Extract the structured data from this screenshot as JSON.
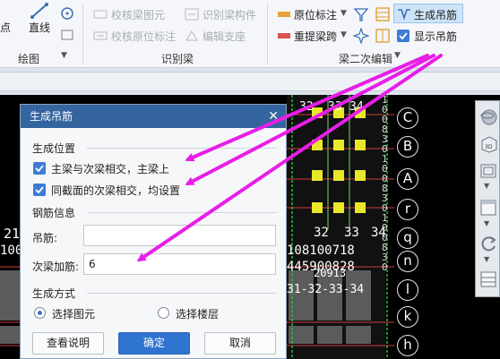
{
  "ribbon": {
    "draw": {
      "dot_label": "点",
      "line_label": "直线",
      "group_label": "绘图"
    },
    "recognize": {
      "check_beam_element": "校核梁图元",
      "recognize_beam_member": "识别梁构件",
      "check_original_annotation": "校核原位标注",
      "edit_support": "编辑支座",
      "group_label": "识别梁"
    },
    "secondary_edit": {
      "original_annotation": "原位标注",
      "reinforce_beam_span": "重提梁跨",
      "generate_hanger": "生成吊筋",
      "show_hanger": "显示吊筋",
      "group_label": "梁二次编辑"
    }
  },
  "canvas": {
    "top_labels": [
      "32",
      "33",
      "34"
    ],
    "mid_labels": [
      "32",
      "33",
      "34"
    ],
    "left_number": "21",
    "left_number2": "100",
    "text_row1": "108100718",
    "text_row2": "445900828",
    "text_row3": "20913",
    "text_row4": "31-32-33-34",
    "axis_labels": [
      "C",
      "B",
      "A",
      "r",
      "q",
      "n",
      "l",
      "k",
      "h"
    ],
    "vertical_text": "100830100830100830"
  },
  "dialog": {
    "title": "生成吊筋",
    "section_position": "生成位置",
    "opt_main_secondary": "主梁与次梁相交，主梁上",
    "opt_same_section": "同截面的次梁相交，均设置",
    "section_rebar": "钢筋信息",
    "hanger_label": "吊筋:",
    "hanger_value": "",
    "secondary_stirrup_label": "次梁加筋:",
    "secondary_stirrup_value": "6",
    "section_method": "生成方式",
    "radio_select_element": "选择图元",
    "radio_select_floor": "选择楼层",
    "btn_help": "查看说明",
    "btn_ok": "确定",
    "btn_cancel": "取消"
  },
  "colors": {
    "arrow": "#e81ee8",
    "title_bar": "#34659f",
    "primary_button": "#2f74d0",
    "grid_red": "#d43a3a",
    "beam_yellow": "#e8e82a",
    "beam_green": "#1fbf3d"
  }
}
